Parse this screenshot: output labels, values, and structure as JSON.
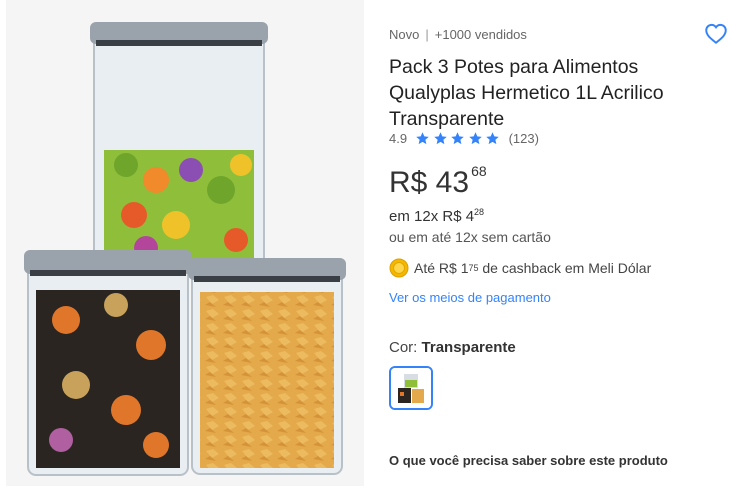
{
  "product": {
    "condition": "Novo",
    "sold": "+1000 vendidos",
    "title": "Pack 3 Potes para Alimentos Qualyplas Hermetico 1L Acrilico Transparente",
    "rating": "4.9",
    "stars": 5,
    "reviews": "(123)",
    "price_main": "R$ 43",
    "price_cents": "68",
    "installments_prefix": "em 12x R$ 4",
    "installments_cents": "28",
    "no_card": "ou em até 12x sem cartão",
    "cashback_prefix": "Até R$ 1",
    "cashback_cents": "75",
    "cashback_suffix": " de cashback em Meli Dólar",
    "payment_link": "Ver os meios de pagamento",
    "color_label": "Cor: ",
    "color_value": "Transparente",
    "section_title": "O que você precisa saber sobre este produto"
  },
  "colors": {
    "accent": "#3483fa",
    "star": "#3483fa",
    "coin": "#f5b700"
  },
  "icons": {
    "favorite": "heart-outline-icon",
    "star": "star-icon",
    "coin": "meli-dolar-coin-icon"
  }
}
